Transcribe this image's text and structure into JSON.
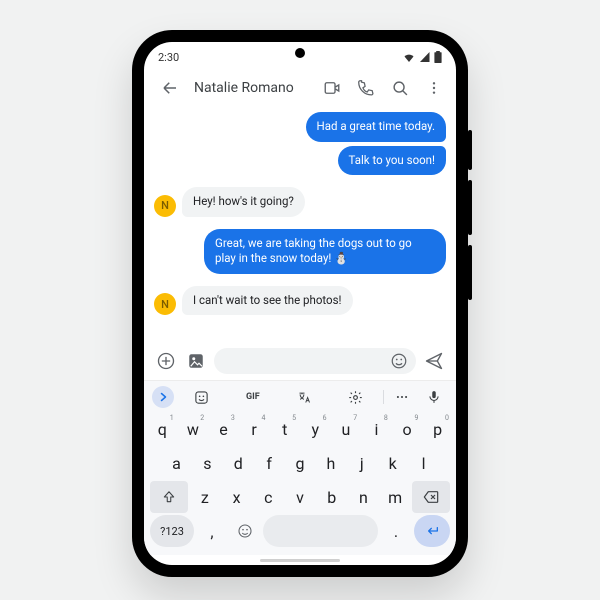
{
  "status": {
    "time": "2:30"
  },
  "header": {
    "contact_name": "Natalie Romano"
  },
  "avatar": {
    "initial": "N"
  },
  "messages": {
    "m1": "Had a great time today.",
    "m2": "Talk to you soon!",
    "m3": "Hey! how's it going?",
    "m4": "Great, we are taking the dogs out to go play in the snow today! ⛄",
    "m5": "I can't wait to see the photos!"
  },
  "keyboard": {
    "gif_label": "GIF",
    "sym_label": "?123",
    "row1": [
      "q",
      "w",
      "e",
      "r",
      "t",
      "y",
      "u",
      "i",
      "o",
      "p"
    ],
    "row1_sup": [
      "1",
      "2",
      "3",
      "4",
      "5",
      "6",
      "7",
      "8",
      "9",
      "0"
    ],
    "row2": [
      "a",
      "s",
      "d",
      "f",
      "g",
      "h",
      "j",
      "k",
      "l"
    ],
    "row3": [
      "z",
      "x",
      "c",
      "v",
      "b",
      "n",
      "m"
    ],
    "comma": ",",
    "period": "."
  }
}
